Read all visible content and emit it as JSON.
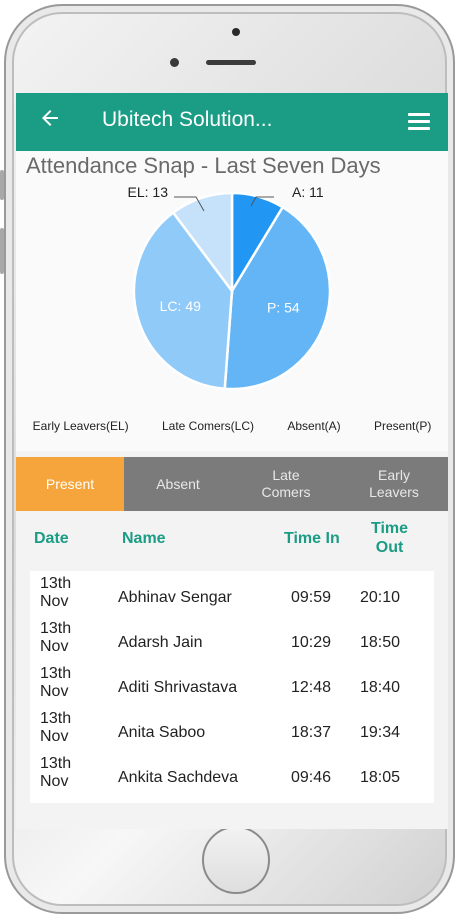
{
  "app": {
    "title": "Ubitech Solution..."
  },
  "chart_data": {
    "type": "pie",
    "title": "Attendance Snap - Last Seven Days",
    "slices": [
      {
        "label": "A",
        "value": 11,
        "color": "#2196f3",
        "text": "A: 11"
      },
      {
        "label": "P",
        "value": 54,
        "color": "#64b5f6",
        "text": "P: 54"
      },
      {
        "label": "LC",
        "value": 49,
        "color": "#90caf9",
        "text": "LC: 49"
      },
      {
        "label": "EL",
        "value": 13,
        "color": "#c6e2fb",
        "text": "EL: 13"
      }
    ],
    "legend": [
      "Early Leavers(EL)",
      "Late Comers(LC)",
      "Absent(A)",
      "Present(P)"
    ]
  },
  "tabs": [
    {
      "label": "Present",
      "active": true
    },
    {
      "label": "Absent",
      "active": false
    },
    {
      "label": "Late Comers",
      "line1": "Late",
      "line2": "Comers",
      "active": false
    },
    {
      "label": "Early Leavers",
      "line1": "Early",
      "line2": "Leavers",
      "active": false
    }
  ],
  "table": {
    "headers": {
      "date": "Date",
      "name": "Name",
      "time_in": "Time In",
      "time_out_1": "Time",
      "time_out_2": "Out"
    },
    "rows": [
      {
        "date1": "13th",
        "date2": "Nov",
        "name": "Abhinav Sengar",
        "in": "09:59",
        "out": "20:10"
      },
      {
        "date1": "13th",
        "date2": "Nov",
        "name": "Adarsh Jain",
        "in": "10:29",
        "out": "18:50"
      },
      {
        "date1": "13th",
        "date2": "Nov",
        "name": "Aditi Shrivastava",
        "in": "12:48",
        "out": "18:40"
      },
      {
        "date1": "13th",
        "date2": "Nov",
        "name": "Anita Saboo",
        "in": "18:37",
        "out": "19:34"
      },
      {
        "date1": "13th",
        "date2": "Nov",
        "name": "Ankita Sachdeva",
        "in": "09:46",
        "out": "18:05"
      }
    ]
  },
  "colors": {
    "appbar": "#1b9c84",
    "tab_active": "#f5a53b",
    "tab_inactive": "#7b7b7b"
  }
}
